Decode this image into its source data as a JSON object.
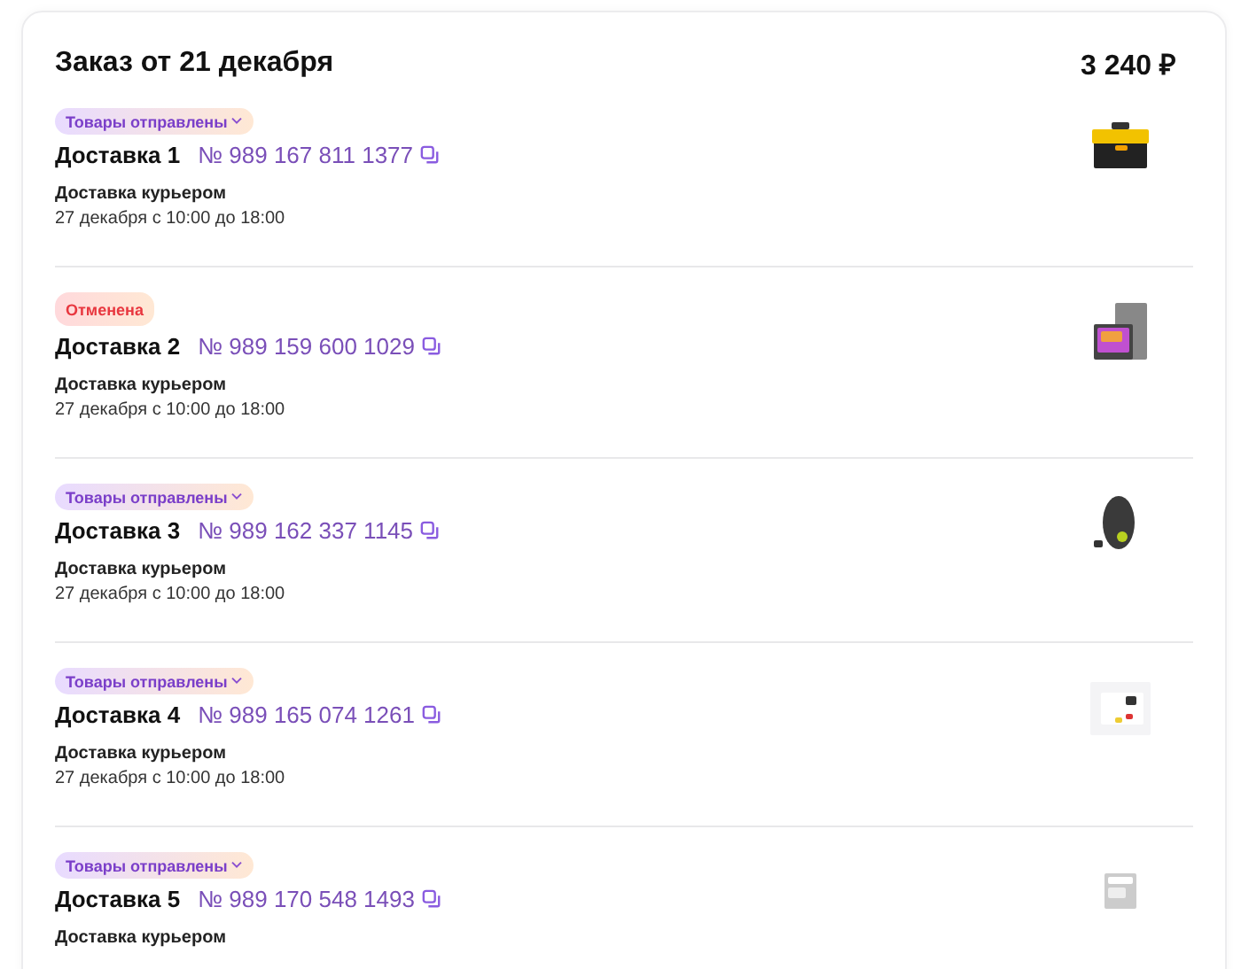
{
  "order": {
    "title": "Заказ от 21 декабря",
    "total": "3 240 ₽"
  },
  "deliveries": [
    {
      "status": {
        "kind": "shipped",
        "label": "Товары отправлены"
      },
      "title": "Доставка 1",
      "number": "№ 989 167 811 1377",
      "method": "Доставка курьером",
      "date": "27 декабря с 10:00 до 18:00"
    },
    {
      "status": {
        "kind": "cancelled",
        "label": "Отменена"
      },
      "title": "Доставка 2",
      "number": "№ 989 159 600 1029",
      "method": "Доставка курьером",
      "date": "27 декабря с 10:00 до 18:00"
    },
    {
      "status": {
        "kind": "shipped",
        "label": "Товары отправлены"
      },
      "title": "Доставка 3",
      "number": "№ 989 162 337 1145",
      "method": "Доставка курьером",
      "date": "27 декабря с 10:00 до 18:00"
    },
    {
      "status": {
        "kind": "shipped",
        "label": "Товары отправлены"
      },
      "title": "Доставка 4",
      "number": "№ 989 165 074 1261",
      "method": "Доставка курьером",
      "date": "27 декабря с 10:00 до 18:00"
    },
    {
      "status": {
        "kind": "shipped",
        "label": "Товары отправлены"
      },
      "title": "Доставка 5",
      "number": "№ 989 170 548 1493",
      "method": "Доставка курьером"
    }
  ]
}
